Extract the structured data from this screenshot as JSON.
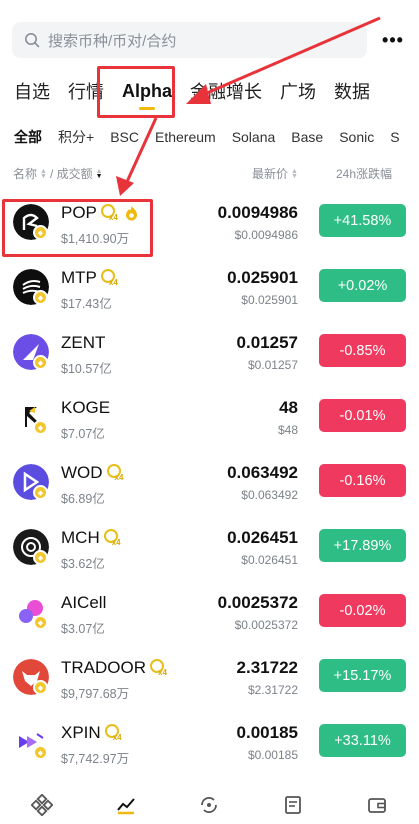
{
  "search": {
    "placeholder": "搜索币种/币对/合约"
  },
  "main_tabs": [
    "自选",
    "行情",
    "Alpha",
    "金融增长",
    "广场",
    "数据"
  ],
  "chain_tabs": [
    "全部",
    "积分+",
    "BSC",
    "Ethereum",
    "Solana",
    "Base",
    "Sonic",
    "S"
  ],
  "columns": {
    "name": "名称",
    "volume": "/ 成交额",
    "price": "最新价",
    "change": "24h涨跌幅"
  },
  "coins": [
    {
      "name": "POP",
      "volume": "$1,410.90万",
      "price": "0.0094986",
      "price_usd": "$0.0094986",
      "change": "+41.58%",
      "dir": "up",
      "icon_bg": "#111111",
      "alpha_mult": "x4",
      "fire": true
    },
    {
      "name": "MTP",
      "volume": "$17.43亿",
      "price": "0.025901",
      "price_usd": "$0.025901",
      "change": "+0.02%",
      "dir": "up",
      "icon_bg": "#0e0e0e",
      "alpha_mult": "x4"
    },
    {
      "name": "ZENT",
      "volume": "$10.57亿",
      "price": "0.01257",
      "price_usd": "$0.01257",
      "change": "-0.85%",
      "dir": "down",
      "icon_bg": "#6b4ee6"
    },
    {
      "name": "KOGE",
      "volume": "$7.07亿",
      "price": "48",
      "price_usd": "$48",
      "change": "-0.01%",
      "dir": "down",
      "icon_bg": "#ffffff"
    },
    {
      "name": "WOD",
      "volume": "$6.89亿",
      "price": "0.063492",
      "price_usd": "$0.063492",
      "change": "-0.16%",
      "dir": "down",
      "icon_bg": "#5b4de0",
      "alpha_mult": "x4"
    },
    {
      "name": "MCH",
      "volume": "$3.62亿",
      "price": "0.026451",
      "price_usd": "$0.026451",
      "change": "+17.89%",
      "dir": "up",
      "icon_bg": "#1a1a1a",
      "alpha_mult": "x4"
    },
    {
      "name": "AICell",
      "volume": "$3.07亿",
      "price": "0.0025372",
      "price_usd": "$0.0025372",
      "change": "-0.02%",
      "dir": "down",
      "icon_bg": "#ffffff"
    },
    {
      "name": "TRADOOR",
      "volume": "$9,797.68万",
      "price": "2.31722",
      "price_usd": "$2.31722",
      "change": "+15.17%",
      "dir": "up",
      "icon_bg": "#e2483a",
      "alpha_mult": "x4"
    },
    {
      "name": "XPIN",
      "volume": "$7,742.97万",
      "price": "0.00185",
      "price_usd": "$0.00185",
      "change": "+33.11%",
      "dir": "up",
      "icon_bg": "#ffffff",
      "alpha_mult": "x4"
    }
  ],
  "colors": {
    "up": "#2ebd85",
    "down": "#f0395e",
    "accent": "#f0b90b",
    "annotation": "#e8333a"
  },
  "bottom_nav": [
    "home-icon",
    "markets-icon",
    "trade-icon",
    "futures-icon",
    "wallet-icon"
  ]
}
